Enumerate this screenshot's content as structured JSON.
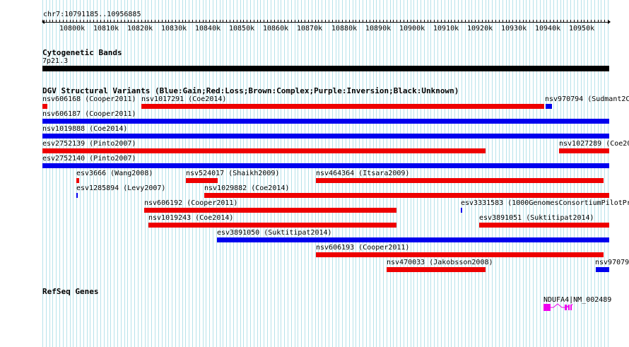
{
  "location": {
    "text": "chr7:10791185..10956885"
  },
  "ruler": {
    "labels": [
      "10800k",
      "10810k",
      "10820k",
      "10830k",
      "10840k",
      "10850k",
      "10860k",
      "10870k",
      "10880k",
      "10890k",
      "10900k",
      "10910k",
      "10920k",
      "10930k",
      "10940k",
      "10950k"
    ]
  },
  "cytoband": {
    "title": "Cytogenetic Bands",
    "band": "7p21.3"
  },
  "dgv": {
    "title": "DGV Structural Variants (Blue:Gain;Red:Loss;Brown:Complex;Purple:Inversion;Black:Unknown)",
    "colors": {
      "gain": "#0000ee",
      "loss": "#ee0000"
    },
    "variants": [
      {
        "label": "nsv606168 (Cooper2011)",
        "type": "loss"
      },
      {
        "label": "nsv1017291 (Coe2014)",
        "type": "loss"
      },
      {
        "label": "nsv970794 (Sudmant2C",
        "type": "gain"
      },
      {
        "label": "nsv606187 (Cooper2011)",
        "type": "gain"
      },
      {
        "label": "nsv1019888 (Coe2014)",
        "type": "gain"
      },
      {
        "label": "esv2752139 (Pinto2007)",
        "type": "loss"
      },
      {
        "label": "nsv1027289 (Coe20",
        "type": "loss"
      },
      {
        "label": "esv2752140 (Pinto2007)",
        "type": "gain"
      },
      {
        "label": "esv3666 (Wang2008)",
        "type": "loss"
      },
      {
        "label": "nsv524017 (Shaikh2009)",
        "type": "loss"
      },
      {
        "label": "nsv464364 (Itsara2009)",
        "type": "loss"
      },
      {
        "label": "esv1285894 (Levy2007)",
        "type": "gain"
      },
      {
        "label": "nsv1029882 (Coe2014)",
        "type": "loss"
      },
      {
        "label": "nsv606192 (Cooper2011)",
        "type": "loss"
      },
      {
        "label": "esv3331583 (1000GenomesConsortiumPilotPr",
        "type": "gain"
      },
      {
        "label": "nsv1019243 (Coe2014)",
        "type": "loss"
      },
      {
        "label": "esv3891051 (Suktitipat2014)",
        "type": "loss"
      },
      {
        "label": "esv3891050 (Suktitipat2014)",
        "type": "gain"
      },
      {
        "label": "nsv606193 (Cooper2011)",
        "type": "loss"
      },
      {
        "label": "nsv470033 (Jakobsson2008)",
        "type": "loss"
      },
      {
        "label": "nsv97079",
        "type": "gain"
      }
    ]
  },
  "refseq": {
    "title": "RefSeq Genes",
    "gene_label": "NDUFA4|NM_002489",
    "color": "#ee00ee"
  }
}
